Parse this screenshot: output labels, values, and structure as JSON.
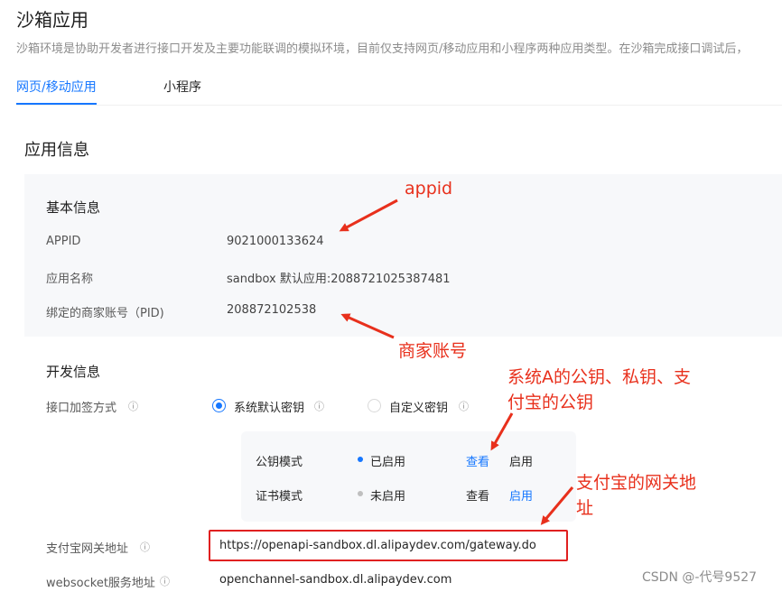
{
  "page": {
    "title": "沙箱应用",
    "description": "沙箱环境是协助开发者进行接口开发及主要功能联调的模拟环境，目前仅支持网页/移动应用和小程序两种应用类型。在沙箱完成接口调试后，"
  },
  "tabs": [
    {
      "label": "网页/移动应用",
      "active": true
    },
    {
      "label": "小程序",
      "active": false
    }
  ],
  "app_info": {
    "section_title": "应用信息",
    "basic": {
      "title": "基本信息",
      "rows": [
        {
          "label": "APPID",
          "value": "9021000133624"
        },
        {
          "label": "应用名称",
          "value": "sandbox 默认应用:2088721025387481"
        },
        {
          "label": "绑定的商家账号（PID)",
          "value": "208872102538"
        }
      ]
    },
    "dev": {
      "title": "开发信息",
      "sign_label": "接口加签方式",
      "options": [
        {
          "label": "系统默认密钥",
          "checked": true
        },
        {
          "label": "自定义密钥",
          "checked": false
        }
      ],
      "modes": [
        {
          "name": "公钥模式",
          "status": "已启用",
          "view": "查看",
          "enable": "启用",
          "status_color": "#1677ff"
        },
        {
          "name": "证书模式",
          "status": "未启用",
          "view": "查看",
          "enable": "启用",
          "status_color": "#bfbfbf"
        }
      ],
      "gateway_label": "支付宝网关地址",
      "gateway_value": "https://openapi-sandbox.dl.alipaydev.com/gateway.do",
      "websocket_label": "websocket服务地址",
      "websocket_value": "openchannel-sandbox.dl.alipaydev.com"
    }
  },
  "annotations": {
    "appid": "appid",
    "merchant": "商家账号",
    "keys_line1": "系统A的公钥、私钥、支",
    "keys_line2": "付宝的公钥",
    "gateway_line1": "支付宝的网关地",
    "gateway_line2": "址",
    "color": "#e8301c"
  },
  "icons": {
    "info": "info-circle-icon"
  },
  "watermark": "CSDN @-代号9527",
  "colors": {
    "accent": "#1677ff",
    "annotation": "#e8301c",
    "highlight_box": "#e02020"
  }
}
